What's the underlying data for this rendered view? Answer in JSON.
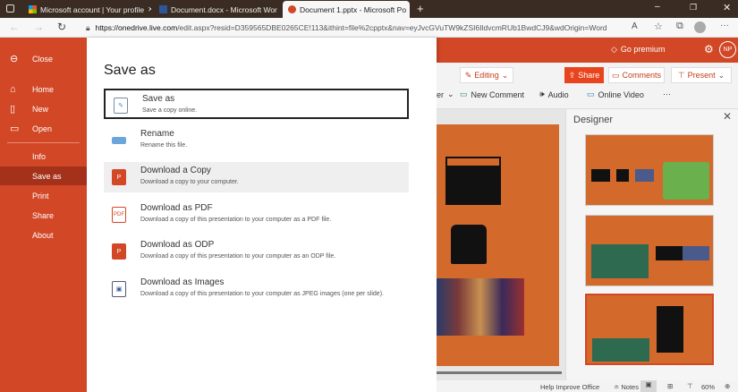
{
  "browser": {
    "tabs": [
      {
        "title": "Microsoft account | Your profile"
      },
      {
        "title": "Document.docx - Microsoft Wor"
      },
      {
        "title": "Document 1.pptx - Microsoft Po"
      }
    ],
    "url_host": "https://onedrive.live.com",
    "url_rest": "/edit.aspx?resid=D359565DBE0265CE!113&ithint=file%2cpptx&nav=eyJvcGVuTW9kZSI6IldvcmRUb1BwdCJ9&wdOrigin=Word"
  },
  "header": {
    "go_premium": "Go premium",
    "avatar": "NP"
  },
  "sidebar": {
    "items": [
      {
        "label": "Close"
      },
      {
        "label": "Home"
      },
      {
        "label": "New"
      },
      {
        "label": "Open"
      },
      {
        "label": "Info"
      },
      {
        "label": "Save as"
      },
      {
        "label": "Print"
      },
      {
        "label": "Share"
      },
      {
        "label": "About"
      }
    ]
  },
  "panel": {
    "title": "Save as",
    "options": [
      {
        "title": "Save as",
        "desc": "Save a copy online."
      },
      {
        "title": "Rename",
        "desc": "Rename this file."
      },
      {
        "title": "Download a Copy",
        "desc": "Download a copy to your computer."
      },
      {
        "title": "Download as PDF",
        "desc": "Download a copy of this presentation to your computer as a PDF file."
      },
      {
        "title": "Download as ODP",
        "desc": "Download a copy of this presentation to your computer as an ODP file."
      },
      {
        "title": "Download as Images",
        "desc": "Download a copy of this presentation to your computer as JPEG images (one per slide)."
      }
    ]
  },
  "ribbon": {
    "editing": "Editing",
    "share": "Share",
    "comments": "Comments",
    "present": "Present",
    "partial": "er",
    "new_comment": "New Comment",
    "audio": "Audio",
    "online_video": "Online Video",
    "more": "···"
  },
  "designer": {
    "title": "Designer"
  },
  "status": {
    "help": "Help Improve Office",
    "notes": "Notes",
    "zoom": "60%"
  },
  "colors": {
    "accent": "#d24726",
    "sidebar_selected": "#a4321a"
  }
}
